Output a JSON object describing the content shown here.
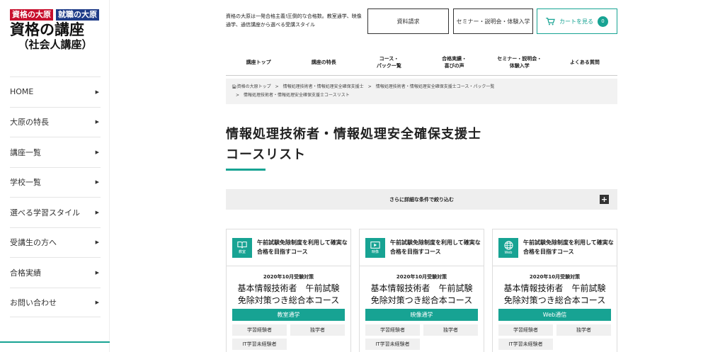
{
  "logo": {
    "tag1": "資格の大原",
    "tag2": "就職の大原",
    "main": "資格の講座",
    "sub": "（社会人講座）"
  },
  "sidebar": {
    "items": [
      {
        "label": "HOME"
      },
      {
        "label": "大原の特長"
      },
      {
        "label": "講座一覧"
      },
      {
        "label": "学校一覧"
      },
      {
        "label": "選べる学習スタイル"
      },
      {
        "label": "受講生の方へ"
      },
      {
        "label": "合格実績"
      },
      {
        "label": "お問い合わせ"
      }
    ]
  },
  "header": {
    "tagline": "資格の大原は一発合格主義!圧倒的な合格数。教室通学、映像通学、通信講座から選べる受講スタイル",
    "request_label": "資料請求",
    "seminar_label": "セミナー・説明会・体験入学",
    "cart_label": "カートを見る",
    "cart_count": "0"
  },
  "gnav": {
    "items": [
      {
        "label": "講座トップ"
      },
      {
        "label": "講座の特長"
      },
      {
        "label": "コース・\nパック一覧"
      },
      {
        "label": "合格実績・\n喜びの声"
      },
      {
        "label": "セミナー・説明会・\n体験入学"
      },
      {
        "label": "よくある質問"
      }
    ]
  },
  "breadcrumb": {
    "items": [
      "資格の大原トップ",
      "情報処理技術者・情報処理安全確保支援士",
      "情報処理技術者・情報処理安全確保支援士コース・パック一覧",
      "情報処理技術者・情報処理安全確保支援士コースリスト"
    ]
  },
  "page": {
    "title_line1": "情報処理技術者・情報処理安全確保支援士",
    "title_line2": "コースリスト",
    "filter_label": "さらに詳細な条件で絞り込む"
  },
  "cards": [
    {
      "icon": "book-icon",
      "icon_label": "教室",
      "desc": "午前試験免除制度を利用して確実な合格を目指すコース",
      "exam": "2020年10月受験対策",
      "name_line1": "基本情報技術者　午前試験",
      "name_line2": "免除対策つき総合本コース",
      "style": "教室通学",
      "tags": [
        "学習経験者",
        "独学者",
        "IT学習未経験者"
      ]
    },
    {
      "icon": "play-icon",
      "icon_label": "映像",
      "desc": "午前試験免除制度を利用して確実な合格を目指すコース",
      "exam": "2020年10月受験対策",
      "name_line1": "基本情報技術者　午前試験",
      "name_line2": "免除対策つき総合本コース",
      "style": "映像通学",
      "tags": [
        "学習経験者",
        "独学者",
        "IT学習未経験者"
      ]
    },
    {
      "icon": "globe-icon",
      "icon_label": "Web",
      "desc": "午前試験免除制度を利用して確実な合格を目指すコース",
      "exam": "2020年10月受験対策",
      "name_line1": "基本情報技術者　午前試験",
      "name_line2": "免除対策つき総合本コース",
      "style": "Web通信",
      "tags": [
        "学習経験者",
        "独学者",
        "IT学習未経験者"
      ]
    }
  ],
  "colors": {
    "accent": "#17a393",
    "brand_red": "#c8102e",
    "brand_blue": "#1f3c88"
  }
}
